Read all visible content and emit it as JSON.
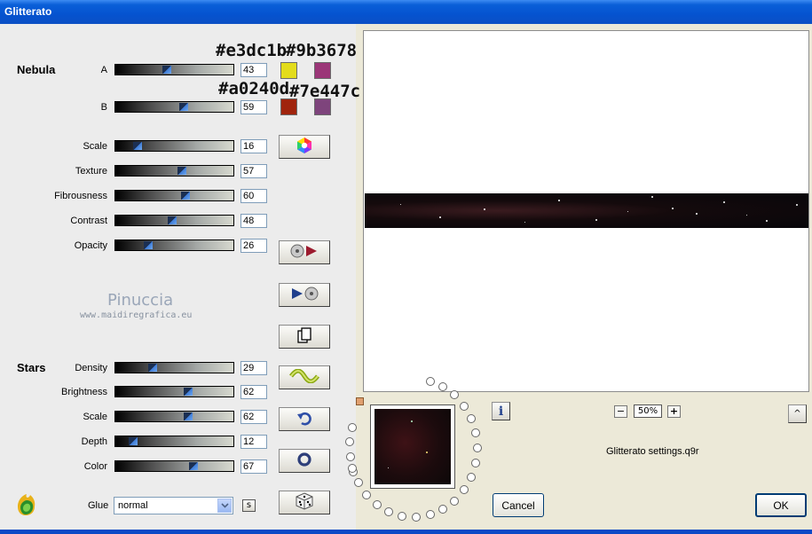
{
  "window": {
    "title": "Glitterato"
  },
  "nebula": {
    "heading": "Nebula",
    "a": {
      "label": "A",
      "value": "43",
      "color1": "#e3dc1b",
      "color2": "#9b3678",
      "hex1": "#e3dc1b",
      "hex2": "#9b3678"
    },
    "b": {
      "label": "B",
      "value": "59",
      "color1": "#a0240d",
      "color2": "#7e447c",
      "hex1": "#a0240d",
      "hex2": "#7e447c"
    },
    "scale": {
      "label": "Scale",
      "value": "16"
    },
    "texture": {
      "label": "Texture",
      "value": "57"
    },
    "fibrousness": {
      "label": "Fibrousness",
      "value": "60"
    },
    "contrast": {
      "label": "Contrast",
      "value": "48"
    },
    "opacity": {
      "label": "Opacity",
      "value": "26"
    }
  },
  "watermark": {
    "name": "Pinuccia",
    "url": "www.maidiregrafica.eu"
  },
  "stars": {
    "heading": "Stars",
    "density": {
      "label": "Density",
      "value": "29"
    },
    "brightness": {
      "label": "Brightness",
      "value": "62"
    },
    "scale": {
      "label": "Scale",
      "value": "62"
    },
    "depth": {
      "label": "Depth",
      "value": "12"
    },
    "color": {
      "label": "Color",
      "value": "67"
    }
  },
  "glue": {
    "label": "Glue",
    "value": "normal",
    "s_button": "s"
  },
  "zoom": {
    "minus": "−",
    "value": "50%",
    "plus": "+"
  },
  "settings_file": "Glitterato settings.q9r",
  "buttons": {
    "cancel": "Cancel",
    "ok": "OK",
    "info": "i",
    "expand": "^"
  },
  "icons": {
    "color-wheel": "hexagon",
    "load-preset": "disk-play",
    "save-preset": "play-disk",
    "copy": "copy",
    "wave": "wave",
    "undo": "undo",
    "reset": "ring",
    "random": "dice"
  }
}
